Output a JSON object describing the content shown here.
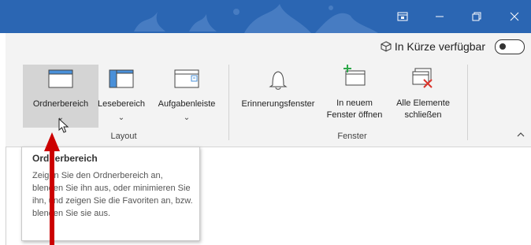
{
  "titlebar": {
    "color": "#2b66b3",
    "restore_icon": "restore-icon",
    "minimize_icon": "minimize-icon",
    "maximize_icon": "maximize-icon",
    "close_icon": "close-icon"
  },
  "ribbon": {
    "coming_soon_label": "In Kürze verfügbar",
    "layout_group": {
      "label": "Layout",
      "buttons": [
        {
          "label": "Ordnerbereich",
          "icon": "folder-pane-icon"
        },
        {
          "label": "Lesebereich",
          "icon": "reading-pane-icon"
        },
        {
          "label": "Aufgabenleiste",
          "icon": "todo-bar-icon"
        }
      ]
    },
    "window_group": {
      "label": "Fenster",
      "buttons": [
        {
          "label": "Erinnerungsfenster",
          "icon": "bell-icon"
        },
        {
          "label_line1": "In neuem",
          "label_line2": "Fenster öffnen",
          "icon": "new-window-icon"
        },
        {
          "label_line1": "Alle Elemente",
          "label_line2": "schließen",
          "icon": "close-all-icon"
        }
      ]
    }
  },
  "tooltip": {
    "title": "Ordnerbereich",
    "body": "Zeigen Sie den Ordnerbereich an, blenden Sie ihn aus, oder minimieren Sie ihn, und zeigen Sie die Favoriten an, bzw. blenden Sie sie aus."
  },
  "annotation": {
    "arrow_color": "#cc0000"
  }
}
